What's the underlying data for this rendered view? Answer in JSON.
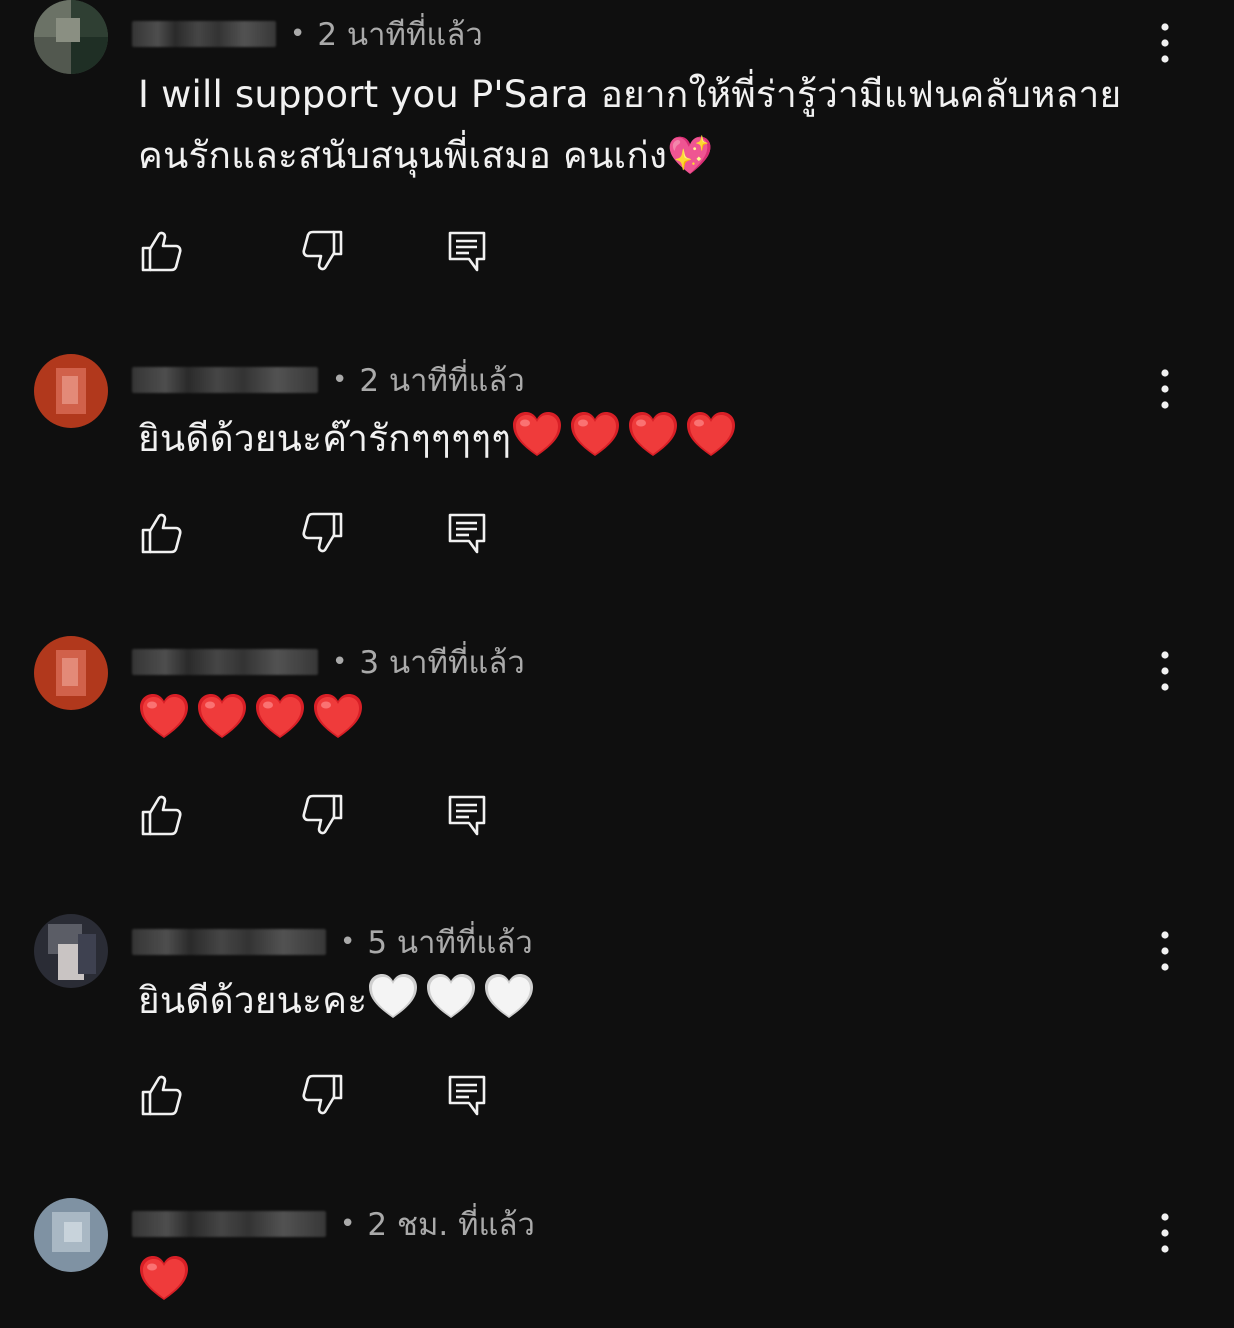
{
  "comments": [
    {
      "time": "2 นาทีที่แล้ว",
      "text": "I will support you P'Sara อยากให้พี่ร่ารู้ว่ามีแฟนคลับหลาย คนรักและสนับสนุนพี่เสมอ คนเก่ง💖"
    },
    {
      "time": "2 นาทีที่แล้ว",
      "text": "ยินดีด้วยนะค๊ารักๆๆๆๆๆ"
    },
    {
      "time": "3 นาทีที่แล้ว",
      "text": ""
    },
    {
      "time": "5 นาทีที่แล้ว",
      "text": "ยินดีด้วยนะคะ"
    },
    {
      "time": "2 ชม. ที่แล้ว",
      "text": ""
    }
  ],
  "separator": "•",
  "icons": {
    "like": "thumbs-up-icon",
    "dislike": "thumbs-down-icon",
    "reply": "reply-icon",
    "more": "more-vertical-icon",
    "heart_red": "red-heart-emoji",
    "heart_white": "white-heart-emoji",
    "sparkling_heart": "sparkling-heart-emoji"
  },
  "colors": {
    "background": "#0f0f0f",
    "text": "#f1f1f1",
    "secondary_text": "#aaaaaa",
    "heart_red": "#e0202a",
    "heart_white": "#f2f2f2"
  }
}
